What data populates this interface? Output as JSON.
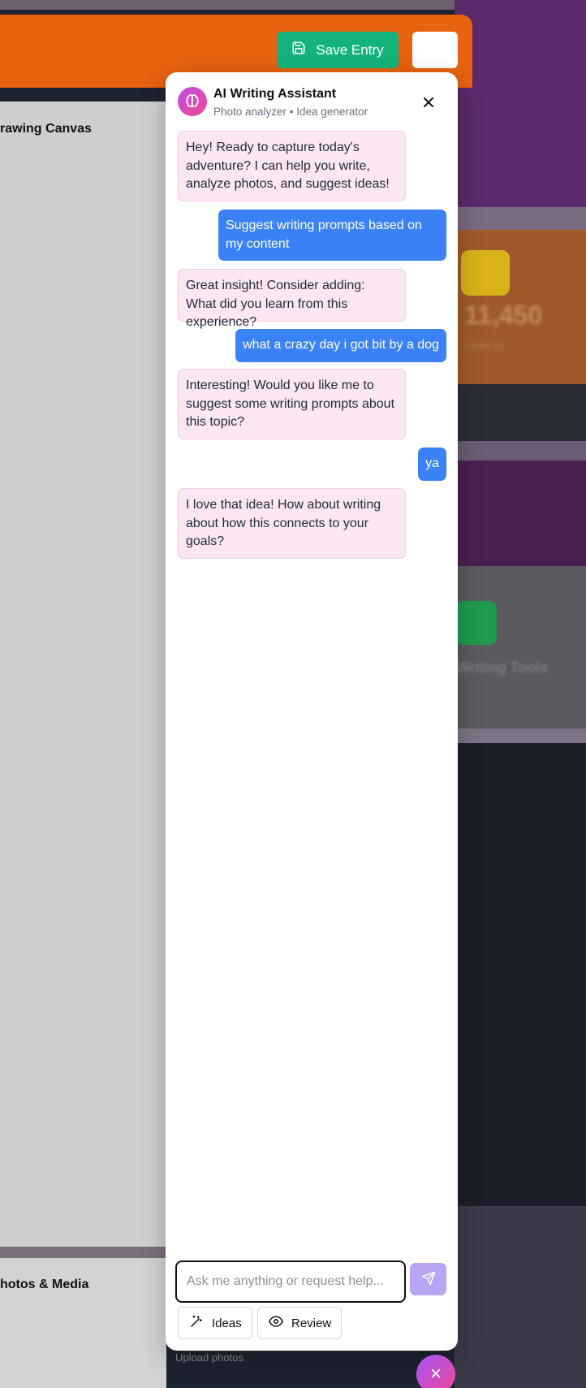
{
  "background": {
    "stat_value": "11,450",
    "stat_sub": "Level 12",
    "tools_label": "Writing Tools",
    "canvas_title": "rawing Canvas",
    "media_title": "hotos & Media",
    "upload_label": "Upload photos"
  },
  "header": {
    "save_label": "Save Entry"
  },
  "assistant": {
    "title": "AI Writing Assistant",
    "subtitle": "Photo analyzer • Idea generator",
    "messages": [
      {
        "role": "ai",
        "text": "Hey! Ready to capture today's adventure? I can help you write, analyze photos, and suggest ideas!"
      },
      {
        "role": "user",
        "text": "Suggest writing prompts based on my content"
      },
      {
        "role": "ai",
        "text": "Great insight! Consider adding: What did you learn from this experience?"
      },
      {
        "role": "user",
        "text": "what a crazy day i got bit by a dog"
      },
      {
        "role": "ai",
        "text": "Interesting! Would you like me to suggest some writing prompts about this topic?"
      },
      {
        "role": "user",
        "text": "ya"
      },
      {
        "role": "ai",
        "text": "I love that idea! How about writing about how this connects to your goals?"
      }
    ],
    "input_placeholder": "Ask me anything or request help...",
    "input_value": "",
    "ideas_label": "Ideas",
    "review_label": "Review"
  },
  "icons": {
    "save": "save-icon",
    "avatar": "brain-icon",
    "close": "close-icon",
    "send": "send-icon",
    "ideas": "magic-wand-icon",
    "review": "eye-icon",
    "fab": "close-icon"
  },
  "colors": {
    "header_orange": "#e8620f",
    "save_green": "#14b37d",
    "user_bubble": "#3b82f6",
    "ai_bubble": "#fbe7f3",
    "send_button": "#b9a5f3"
  }
}
